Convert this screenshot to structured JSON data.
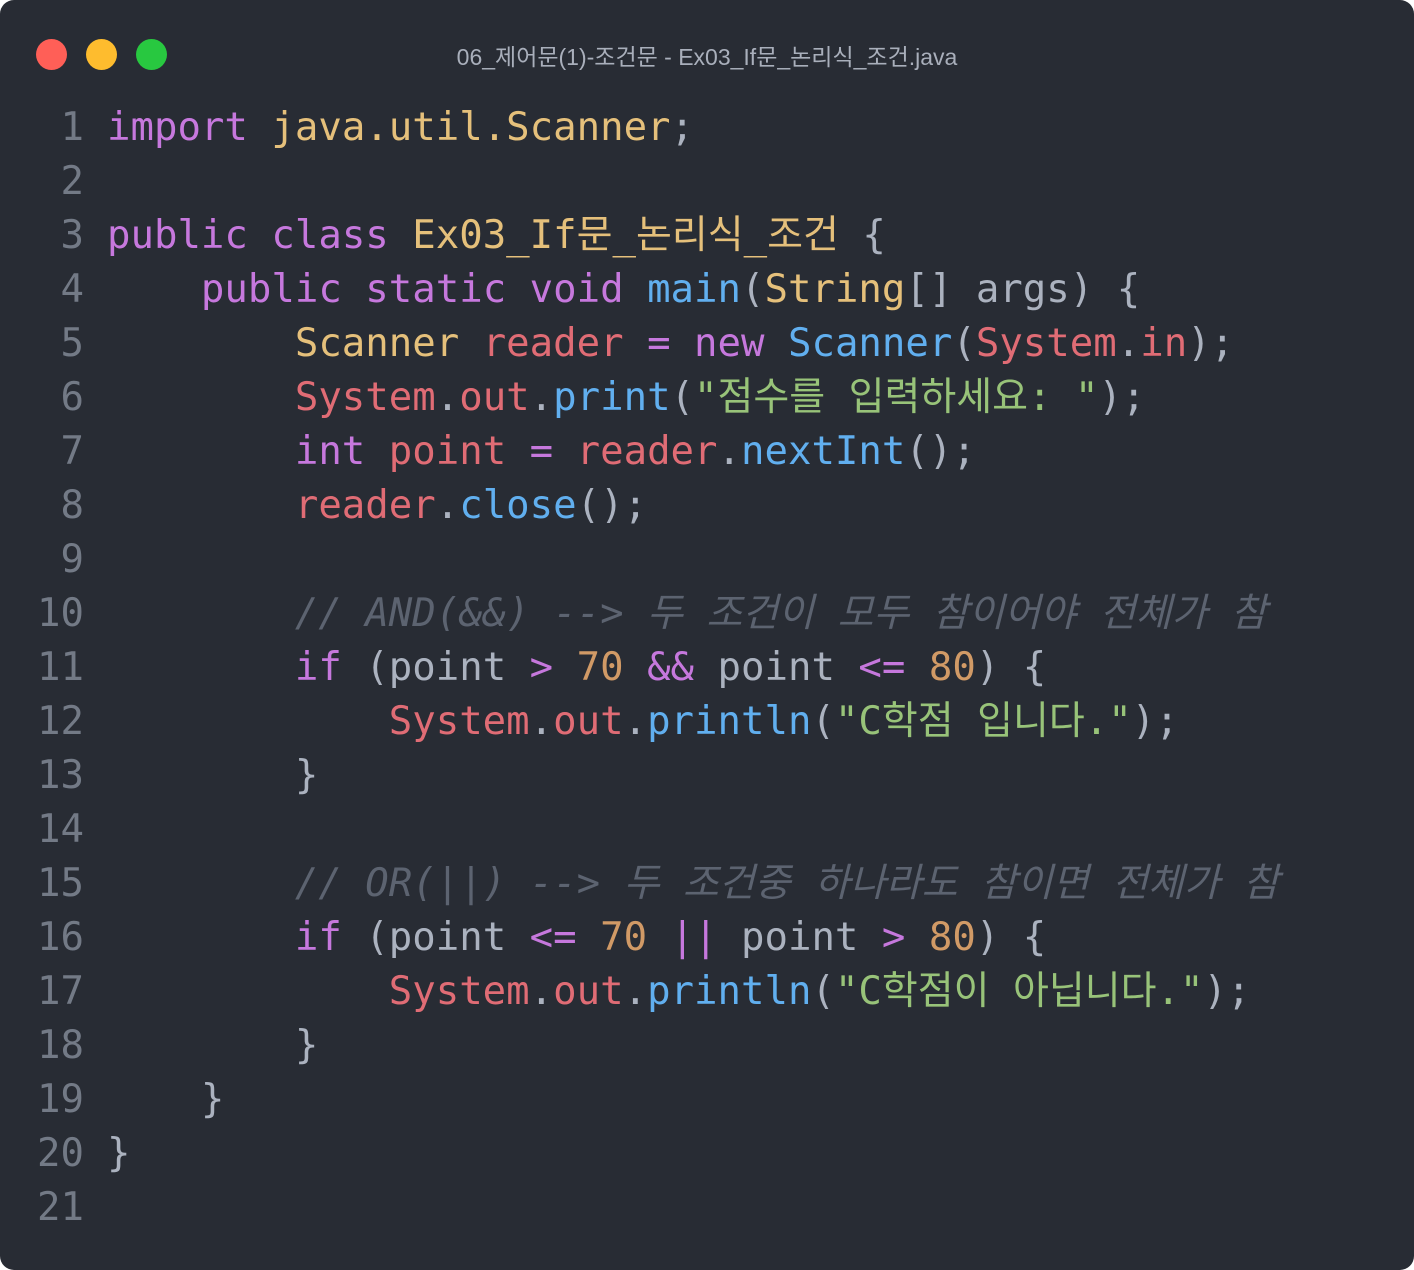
{
  "window": {
    "title": "06_제어문(1)-조건문 - Ex03_If문_논리식_조건.java",
    "traffic_lights": [
      {
        "name": "close",
        "color": "#ff5f57"
      },
      {
        "name": "minimize",
        "color": "#febc2e"
      },
      {
        "name": "zoom",
        "color": "#28c840"
      }
    ]
  },
  "theme": {
    "background": "#282c34",
    "keyword": "#c678dd",
    "class": "#e5c07b",
    "variable": "#e06c75",
    "function": "#61afef",
    "string": "#98c379",
    "number": "#d19a66",
    "comment": "#5c6370",
    "plain": "#abb2bf",
    "line_number": "#737a86"
  },
  "editor": {
    "lines": [
      {
        "n": "1",
        "t": [
          [
            "kw",
            "import"
          ],
          [
            "pl",
            " "
          ],
          [
            "cls",
            "java.util.Scanner"
          ],
          [
            "pl",
            ";"
          ]
        ]
      },
      {
        "n": "2",
        "t": []
      },
      {
        "n": "3",
        "t": [
          [
            "kw",
            "public"
          ],
          [
            "pl",
            " "
          ],
          [
            "kw",
            "class"
          ],
          [
            "pl",
            " "
          ],
          [
            "cls",
            "Ex03_If문_논리식_조건"
          ],
          [
            "pl",
            " {"
          ]
        ]
      },
      {
        "n": "4",
        "t": [
          [
            "pl",
            "    "
          ],
          [
            "kw",
            "public"
          ],
          [
            "pl",
            " "
          ],
          [
            "kw",
            "static"
          ],
          [
            "pl",
            " "
          ],
          [
            "kw",
            "void"
          ],
          [
            "pl",
            " "
          ],
          [
            "fn",
            "main"
          ],
          [
            "pl",
            "("
          ],
          [
            "cls",
            "String"
          ],
          [
            "pl",
            "[] args) {"
          ]
        ]
      },
      {
        "n": "5",
        "t": [
          [
            "pl",
            "        "
          ],
          [
            "cls",
            "Scanner"
          ],
          [
            "pl",
            " "
          ],
          [
            "var",
            "reader"
          ],
          [
            "pl",
            " "
          ],
          [
            "op",
            "="
          ],
          [
            "pl",
            " "
          ],
          [
            "kw",
            "new"
          ],
          [
            "pl",
            " "
          ],
          [
            "fn",
            "Scanner"
          ],
          [
            "pl",
            "("
          ],
          [
            "var",
            "System"
          ],
          [
            "pl",
            "."
          ],
          [
            "var",
            "in"
          ],
          [
            "pl",
            ");"
          ]
        ]
      },
      {
        "n": "6",
        "t": [
          [
            "pl",
            "        "
          ],
          [
            "var",
            "System"
          ],
          [
            "pl",
            "."
          ],
          [
            "var",
            "out"
          ],
          [
            "pl",
            "."
          ],
          [
            "fn",
            "print"
          ],
          [
            "pl",
            "("
          ],
          [
            "str",
            "\"점수를 입력하세요: \""
          ],
          [
            "pl",
            ");"
          ]
        ]
      },
      {
        "n": "7",
        "t": [
          [
            "pl",
            "        "
          ],
          [
            "kw",
            "int"
          ],
          [
            "pl",
            " "
          ],
          [
            "var",
            "point"
          ],
          [
            "pl",
            " "
          ],
          [
            "op",
            "="
          ],
          [
            "pl",
            " "
          ],
          [
            "var",
            "reader"
          ],
          [
            "pl",
            "."
          ],
          [
            "fn",
            "nextInt"
          ],
          [
            "pl",
            "();"
          ]
        ]
      },
      {
        "n": "8",
        "t": [
          [
            "pl",
            "        "
          ],
          [
            "var",
            "reader"
          ],
          [
            "pl",
            "."
          ],
          [
            "fn",
            "close"
          ],
          [
            "pl",
            "();"
          ]
        ]
      },
      {
        "n": "9",
        "t": []
      },
      {
        "n": "10",
        "t": [
          [
            "pl",
            "        "
          ],
          [
            "cm",
            "// AND(&&) --> 두 조건이 모두 참이어야 전체가 참"
          ]
        ]
      },
      {
        "n": "11",
        "t": [
          [
            "pl",
            "        "
          ],
          [
            "kw",
            "if"
          ],
          [
            "pl",
            " (point "
          ],
          [
            "op",
            ">"
          ],
          [
            "pl",
            " "
          ],
          [
            "num",
            "70"
          ],
          [
            "pl",
            " "
          ],
          [
            "op",
            "&&"
          ],
          [
            "pl",
            " point "
          ],
          [
            "op",
            "<="
          ],
          [
            "pl",
            " "
          ],
          [
            "num",
            "80"
          ],
          [
            "pl",
            ") {"
          ]
        ]
      },
      {
        "n": "12",
        "t": [
          [
            "pl",
            "            "
          ],
          [
            "var",
            "System"
          ],
          [
            "pl",
            "."
          ],
          [
            "var",
            "out"
          ],
          [
            "pl",
            "."
          ],
          [
            "fn",
            "println"
          ],
          [
            "pl",
            "("
          ],
          [
            "str",
            "\"C학점 입니다.\""
          ],
          [
            "pl",
            ");"
          ]
        ]
      },
      {
        "n": "13",
        "t": [
          [
            "pl",
            "        }"
          ]
        ]
      },
      {
        "n": "14",
        "t": []
      },
      {
        "n": "15",
        "t": [
          [
            "pl",
            "        "
          ],
          [
            "cm",
            "// OR(||) --> 두 조건중 하나라도 참이면 전체가 참"
          ]
        ]
      },
      {
        "n": "16",
        "t": [
          [
            "pl",
            "        "
          ],
          [
            "kw",
            "if"
          ],
          [
            "pl",
            " (point "
          ],
          [
            "op",
            "<="
          ],
          [
            "pl",
            " "
          ],
          [
            "num",
            "70"
          ],
          [
            "pl",
            " "
          ],
          [
            "op",
            "||"
          ],
          [
            "pl",
            " point "
          ],
          [
            "op",
            ">"
          ],
          [
            "pl",
            " "
          ],
          [
            "num",
            "80"
          ],
          [
            "pl",
            ") {"
          ]
        ]
      },
      {
        "n": "17",
        "t": [
          [
            "pl",
            "            "
          ],
          [
            "var",
            "System"
          ],
          [
            "pl",
            "."
          ],
          [
            "var",
            "out"
          ],
          [
            "pl",
            "."
          ],
          [
            "fn",
            "println"
          ],
          [
            "pl",
            "("
          ],
          [
            "str",
            "\"C학점이 아닙니다.\""
          ],
          [
            "pl",
            ");"
          ]
        ]
      },
      {
        "n": "18",
        "t": [
          [
            "pl",
            "        }"
          ]
        ]
      },
      {
        "n": "19",
        "t": [
          [
            "pl",
            "    }"
          ]
        ]
      },
      {
        "n": "20",
        "t": [
          [
            "pl",
            "}"
          ]
        ]
      },
      {
        "n": "21",
        "t": []
      }
    ]
  }
}
